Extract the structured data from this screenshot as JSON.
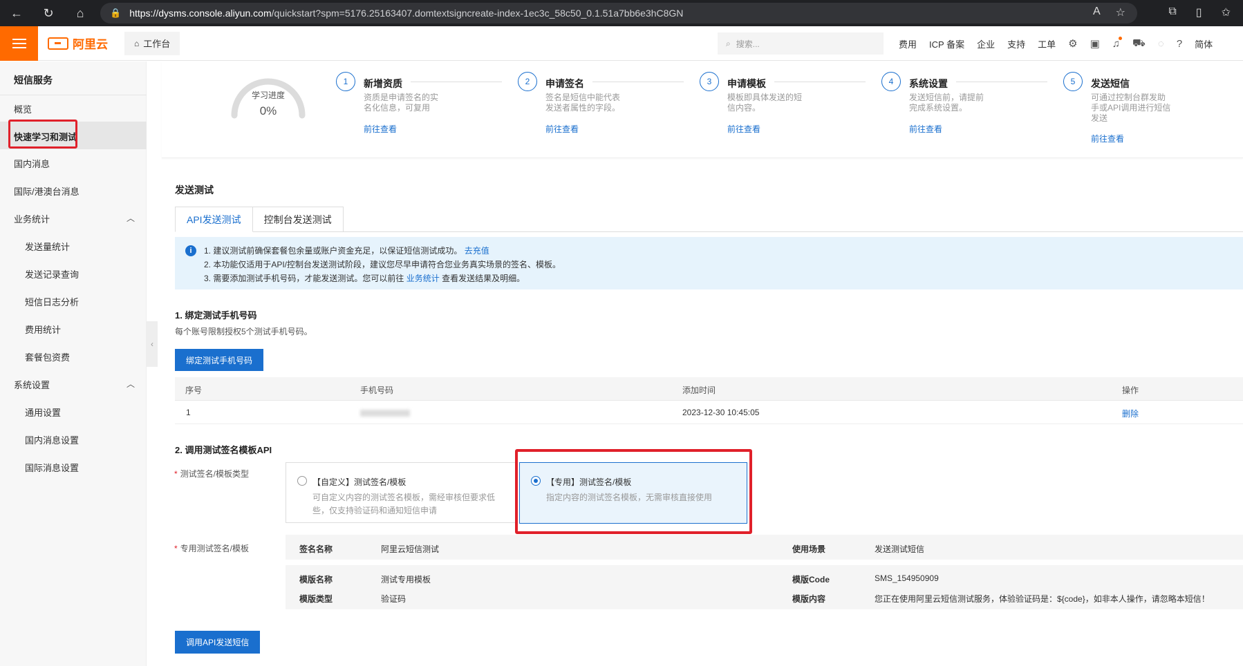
{
  "browser": {
    "url_host": "https://dysms.console.aliyun.com",
    "url_path": "/quickstart?spm=5176.25163407.domtextsigncreate-index-1ec3c_58c50_0.1.51a7bb6e3hC8GN"
  },
  "header": {
    "logo_text": "阿里云",
    "workbench": "工作台",
    "search_placeholder": "搜索...",
    "links": [
      "费用",
      "ICP 备案",
      "企业",
      "支持",
      "工单"
    ],
    "lang": "简体"
  },
  "sidebar": {
    "title": "短信服务",
    "items": {
      "overview": "概览",
      "quickstart": "快速学习和测试",
      "domestic": "国内消息",
      "intl": "国际/港澳台消息",
      "stats": "业务统计",
      "send_volume": "发送量统计",
      "send_records": "发送记录查询",
      "log_analysis": "短信日志分析",
      "cost_stats": "费用统计",
      "package": "套餐包资费",
      "system": "系统设置",
      "general": "通用设置",
      "domestic_settings": "国内消息设置",
      "intl_settings": "国际消息设置"
    }
  },
  "progress": {
    "label": "学习进度",
    "value": "0%",
    "value_fraction": 0,
    "steps": [
      {
        "num": "1",
        "title": "新增资质",
        "desc": "资质是申请签名的实名化信息，可复用",
        "link": "前往查看"
      },
      {
        "num": "2",
        "title": "申请签名",
        "desc": "签名是短信中能代表发送者属性的字段。",
        "link": "前往查看"
      },
      {
        "num": "3",
        "title": "申请模板",
        "desc": "模板即具体发送的短信内容。",
        "link": "前往查看"
      },
      {
        "num": "4",
        "title": "系统设置",
        "desc": "发送短信前，请提前完成系统设置。",
        "link": "前往查看"
      },
      {
        "num": "5",
        "title": "发送短信",
        "desc": "可通过控制台群发助手或API调用进行短信发送",
        "link": "前往查看"
      }
    ]
  },
  "send_test": {
    "title": "发送测试",
    "tabs": [
      "API发送测试",
      "控制台发送测试"
    ],
    "notice": {
      "line1": "1. 建议测试前确保套餐包余量或账户资金充足，以保证短信测试成功。",
      "line1_link": "去充值",
      "line2": "2. 本功能仅适用于API/控制台发送测试阶段，建议您尽早申请符合您业务真实场景的签名、模板。",
      "line3": "3. 需要添加测试手机号码，才能发送测试。您可以前往",
      "line3_link": "业务统计",
      "line3_tail": "查看发送结果及明细。"
    },
    "bind": {
      "title": "1. 绑定测试手机号码",
      "hint": "每个账号限制授权5个测试手机号码。",
      "button": "绑定测试手机号码",
      "columns": [
        "序号",
        "手机号码",
        "添加时间",
        "操作"
      ],
      "rows": [
        {
          "index": "1",
          "added": "2023-12-30 10:45:05",
          "action": "删除"
        }
      ]
    },
    "api": {
      "title": "2. 调用测试签名模板API",
      "type_label": "测试签名/模板类型",
      "option_custom_title": "【自定义】测试签名/模板",
      "option_custom_desc1": "可自定义内容的测试签名模板，需经审核但要求低",
      "option_custom_desc2": "些，仅支持验证码和通知短信申请",
      "option_dedicated_title": "【专用】测试签名/模板",
      "option_dedicated_desc": "指定内容的测试签名模板，无需审核直接使用",
      "dedicated_label": "专用测试签名/模板",
      "sign_name_k": "签名名称",
      "sign_name_v": "阿里云短信测试",
      "scene_k": "使用场景",
      "scene_v": "发送测试短信",
      "tpl_name_k": "模版名称",
      "tpl_name_v": "测试专用模板",
      "tpl_code_k": "模版Code",
      "tpl_code_v": "SMS_154950909",
      "tpl_type_k": "模版类型",
      "tpl_type_v": "验证码",
      "tpl_content_k": "模版内容",
      "tpl_content_v": "您正在使用阿里云短信测试服务，体验验证码是：${code}，如非本人操作，请忽略本短信！",
      "send_button": "调用API发送短信"
    }
  },
  "colors": {
    "brand": "#ff6a00",
    "primary": "#1a6fce",
    "highlight": "#e0202a"
  }
}
